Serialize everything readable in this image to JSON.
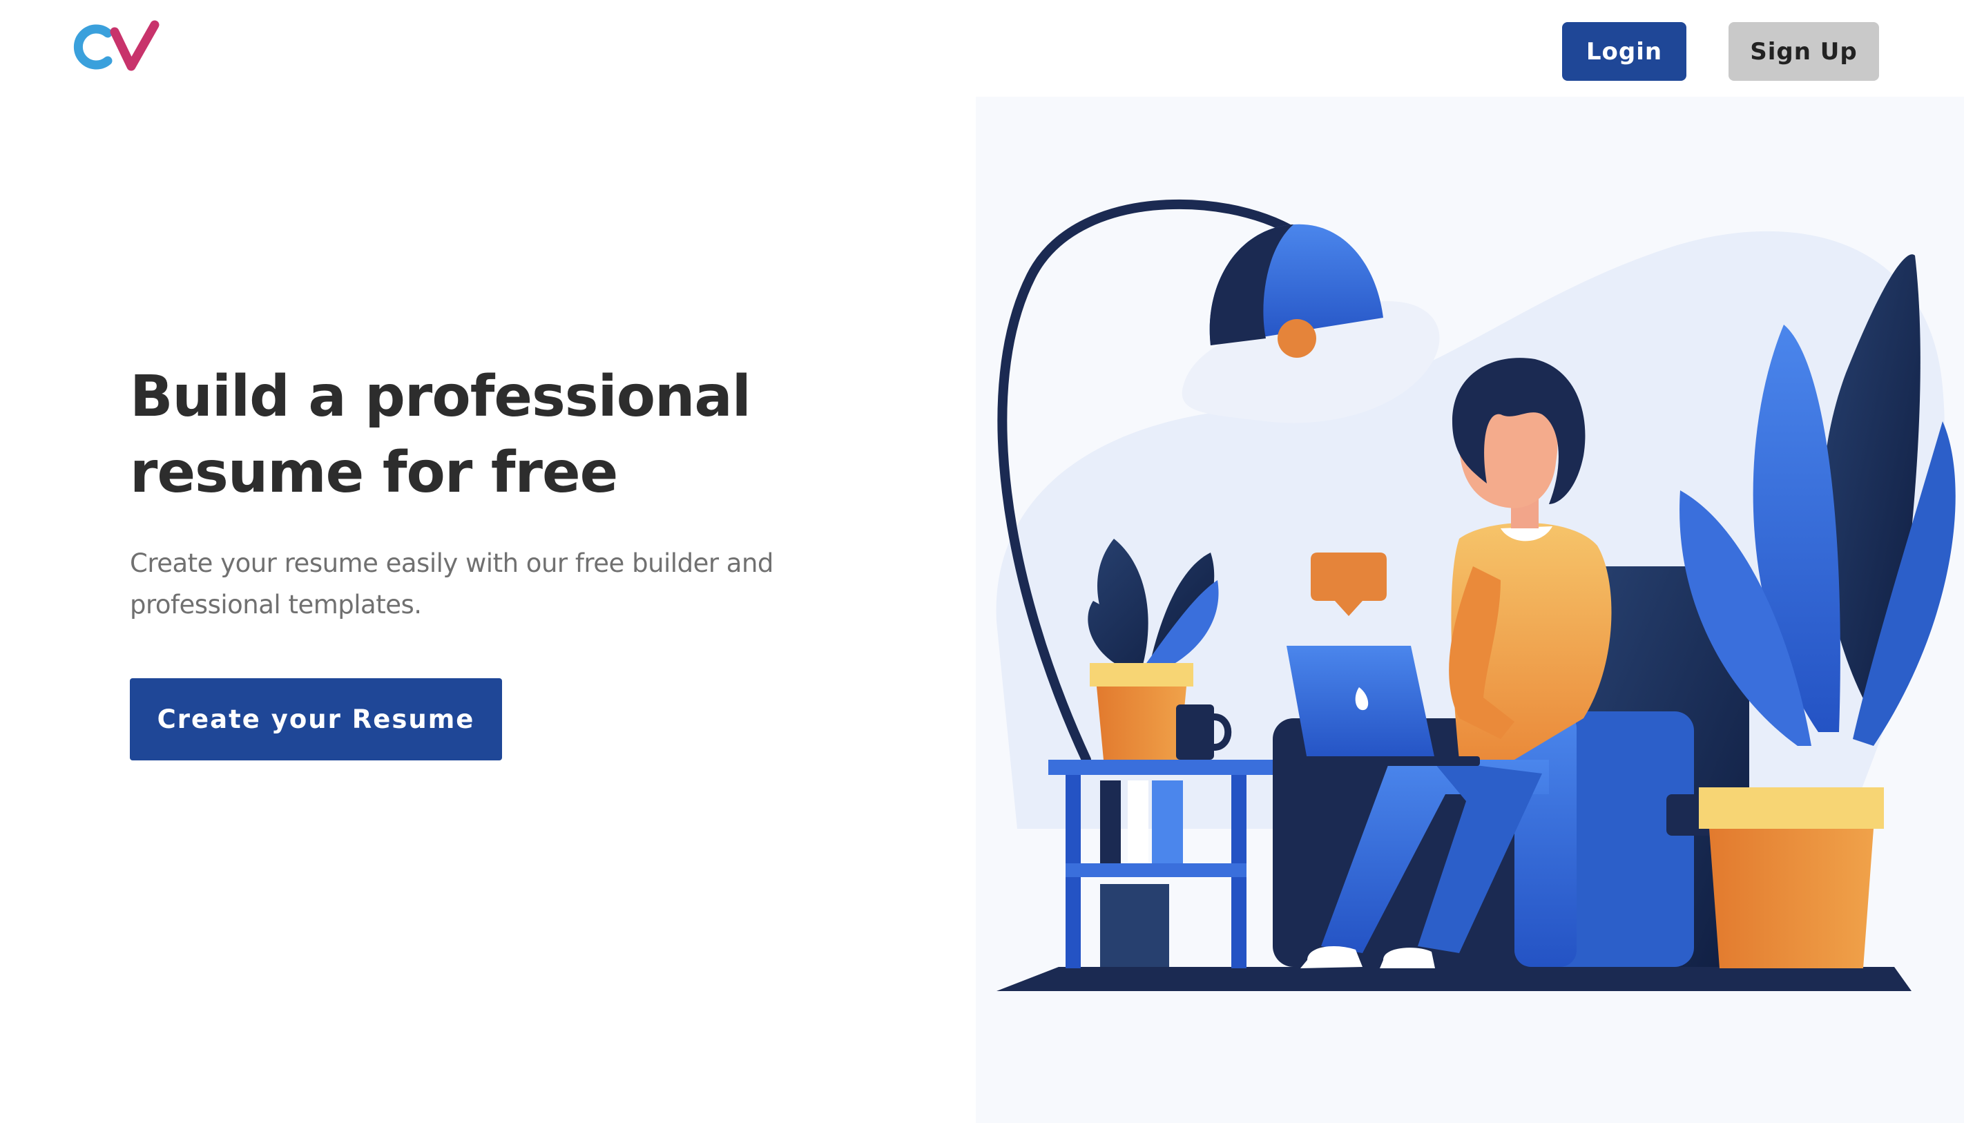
{
  "header": {
    "logo_name": "CV logo",
    "login_label": "Login",
    "signup_label": "Sign Up"
  },
  "hero": {
    "title_line1": "Build a professional",
    "title_line2": "resume for free",
    "subtitle_line1": "Create your resume easily with our free builder and",
    "subtitle_line2": "professional templates.",
    "cta_label": "Create your Resume"
  },
  "illustration": {
    "name": "woman-working-on-laptop-illustration"
  },
  "colors": {
    "primary": "#1f4797",
    "secondary_button": "#c9c9c9",
    "title_text": "#2d2d2d",
    "body_text": "#707070",
    "illustration_blue": "#3a6fdc",
    "illustration_navy": "#1b2a52",
    "illustration_orange": "#e5843a",
    "illustration_yellow": "#f7d574"
  }
}
